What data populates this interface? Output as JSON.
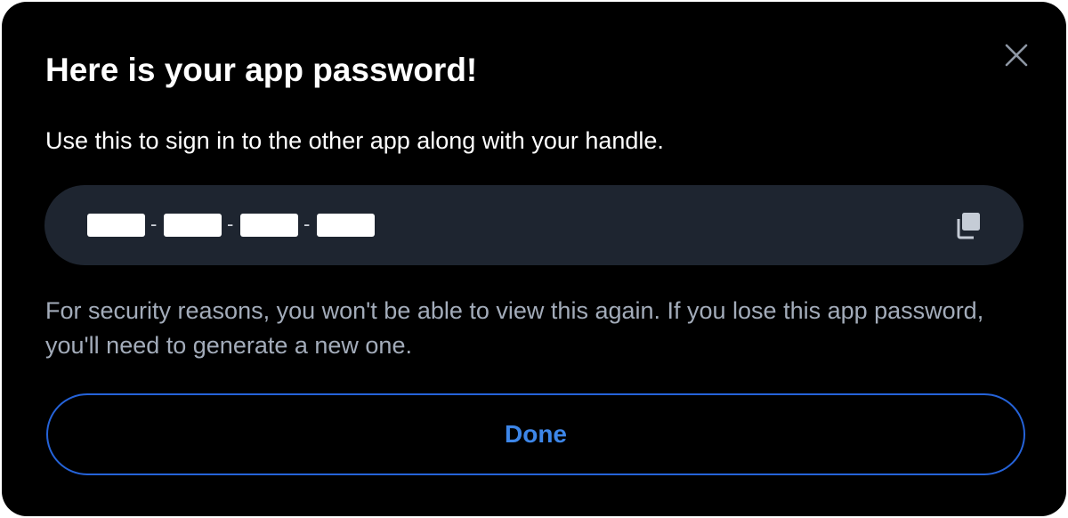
{
  "dialog": {
    "title": "Here is your app password!",
    "subtitle": "Use this to sign in to the other app along with your handle.",
    "password": {
      "segments": [
        "",
        "",
        "",
        ""
      ],
      "separator": "-",
      "redacted": true,
      "copy_icon": "copy-icon"
    },
    "warning": "For security reasons, you won't be able to view this again. If you lose this app password, you'll need to generate a new one.",
    "done_label": "Done",
    "close_icon": "close-icon"
  },
  "colors": {
    "background": "#000000",
    "field_background": "#1e2530",
    "accent": "#3d86e8",
    "button_border": "#2563d9",
    "muted_text": "#a3acba"
  }
}
